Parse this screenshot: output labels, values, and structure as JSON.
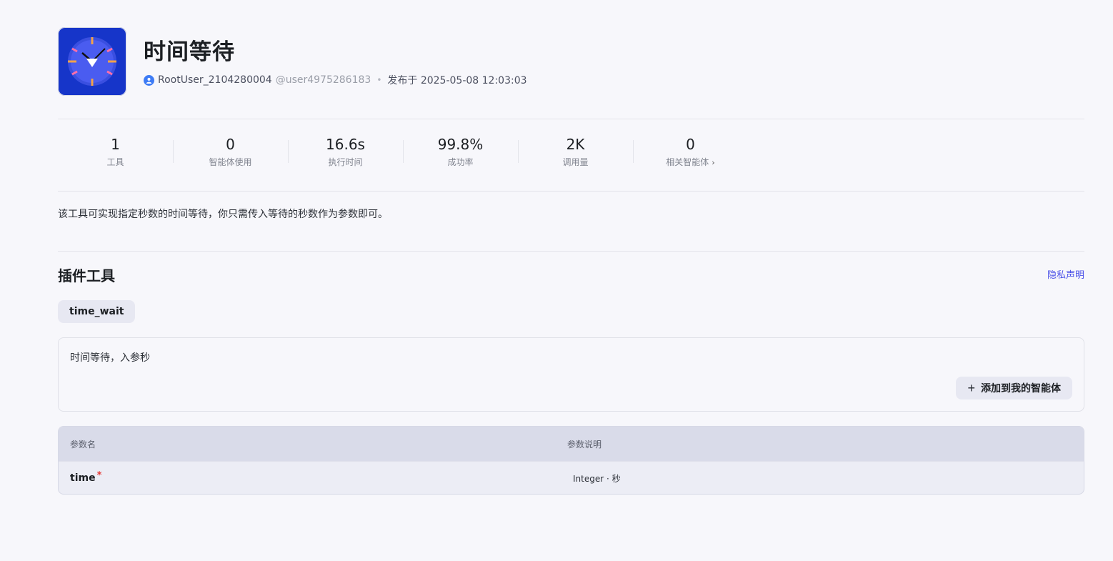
{
  "plugin": {
    "title": "时间等待",
    "author": "RootUser_2104280004",
    "handle": "@user4975286183",
    "separator": "•",
    "published": "发布于 2025-05-08 12:03:03"
  },
  "stats": [
    {
      "value": "1",
      "label": "工具"
    },
    {
      "value": "0",
      "label": "智能体使用"
    },
    {
      "value": "16.6s",
      "label": "执行时间"
    },
    {
      "value": "99.8%",
      "label": "成功率"
    },
    {
      "value": "2K",
      "label": "调用量"
    },
    {
      "value": "0",
      "label": "相关智能体"
    }
  ],
  "description": "该工具可实现指定秒数的时间等待，你只需传入等待的秒数作为参数即可。",
  "tools_section": {
    "title": "插件工具",
    "privacy_link": "隐私声明",
    "tool_name": "time_wait",
    "tool_description": "时间等待，入参秒",
    "add_button": "添加到我的智能体"
  },
  "params_table": {
    "headers": [
      "参数名",
      "参数说明"
    ],
    "rows": [
      {
        "name": "time",
        "required_mark": "*",
        "desc": "Integer · 秒"
      }
    ]
  },
  "colors": {
    "accent": "#4d53e8",
    "icon_bg": "#1635c9",
    "required": "#e53935"
  }
}
